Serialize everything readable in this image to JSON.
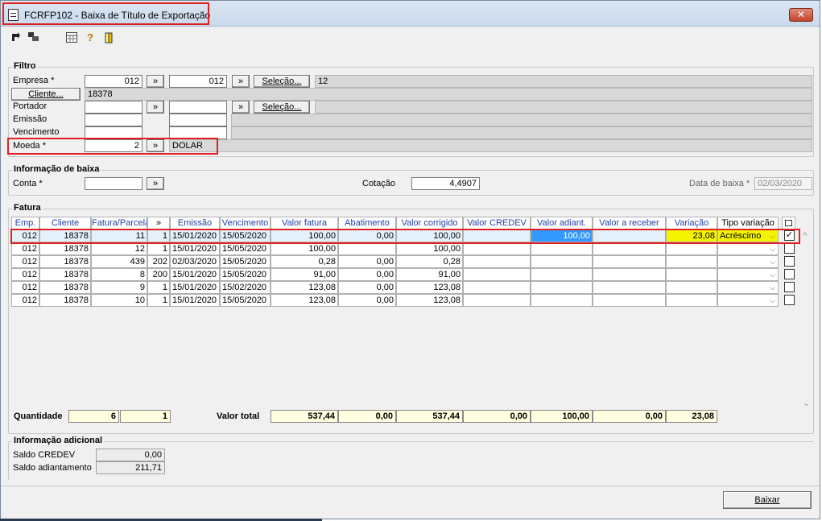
{
  "window": {
    "title": "FCRFP102 - Baixa de Título de Exportação",
    "close_symbol": "✕"
  },
  "toolbar": {
    "icons": [
      "arrow-left-icon",
      "grid-arrow-icon",
      "calendar-icon",
      "help-icon",
      "exit-door-icon"
    ]
  },
  "filtro": {
    "title": "Filtro",
    "empresa_label": "Empresa *",
    "empresa_from": "012",
    "empresa_to": "012",
    "selecao_label": "Seleção...",
    "empresa_selection": "12",
    "cliente_button": "Cliente...",
    "cliente_value": "18378",
    "portador_label": "Portador",
    "portador_selecao_label": "Seleção...",
    "emissao_label": "Emissão",
    "vencimento_label": "Vencimento",
    "moeda_label": "Moeda *",
    "moeda_value": "2",
    "moeda_name": "DOLAR",
    "lookup_symbol": "»"
  },
  "baixa": {
    "title": "Informação de baixa",
    "conta_label": "Conta *",
    "conta_value": "",
    "cotacao_label": "Cotação",
    "cotacao_value": "4,4907",
    "data_label": "Data de baixa *",
    "data_value": "02/03/2020"
  },
  "fatura": {
    "title": "Fatura",
    "columns": [
      "Emp.",
      "Cliente",
      "Fatura/Parcela",
      "»",
      "Emissão",
      "Vencimento",
      "Valor fatura",
      "Abatimento",
      "Valor corrigido",
      "Valor CREDEV",
      "Valor adiant.",
      "Valor a receber",
      "Variação",
      "Tipo variação"
    ],
    "rows": [
      {
        "emp": "012",
        "cliente": "18378",
        "fatura": "11",
        "parcela": "1",
        "emissao": "15/01/2020",
        "vencimento": "15/05/2020",
        "valor_fatura": "100,00",
        "abatimento": "0,00",
        "valor_corrigido": "100,00",
        "credev": "",
        "adiant": "100,00",
        "receber": "",
        "variacao": "23,08",
        "tipo": "Acréscimo",
        "checked": true
      },
      {
        "emp": "012",
        "cliente": "18378",
        "fatura": "12",
        "parcela": "1",
        "emissao": "15/01/2020",
        "vencimento": "15/05/2020",
        "valor_fatura": "100,00",
        "abatimento": "",
        "valor_corrigido": "100,00",
        "credev": "",
        "adiant": "",
        "receber": "",
        "variacao": "",
        "tipo": "",
        "checked": false
      },
      {
        "emp": "012",
        "cliente": "18378",
        "fatura": "439",
        "parcela": "202",
        "emissao": "02/03/2020",
        "vencimento": "15/05/2020",
        "valor_fatura": "0,28",
        "abatimento": "0,00",
        "valor_corrigido": "0,28",
        "credev": "",
        "adiant": "",
        "receber": "",
        "variacao": "",
        "tipo": "",
        "checked": false
      },
      {
        "emp": "012",
        "cliente": "18378",
        "fatura": "8",
        "parcela": "200",
        "emissao": "15/01/2020",
        "vencimento": "15/05/2020",
        "valor_fatura": "91,00",
        "abatimento": "0,00",
        "valor_corrigido": "91,00",
        "credev": "",
        "adiant": "",
        "receber": "",
        "variacao": "",
        "tipo": "",
        "checked": false
      },
      {
        "emp": "012",
        "cliente": "18378",
        "fatura": "9",
        "parcela": "1",
        "emissao": "15/01/2020",
        "vencimento": "15/02/2020",
        "valor_fatura": "123,08",
        "abatimento": "0,00",
        "valor_corrigido": "123,08",
        "credev": "",
        "adiant": "",
        "receber": "",
        "variacao": "",
        "tipo": "",
        "checked": false
      },
      {
        "emp": "012",
        "cliente": "18378",
        "fatura": "10",
        "parcela": "1",
        "emissao": "15/01/2020",
        "vencimento": "15/05/2020",
        "valor_fatura": "123,08",
        "abatimento": "0,00",
        "valor_corrigido": "123,08",
        "credev": "",
        "adiant": "",
        "receber": "",
        "variacao": "",
        "tipo": "",
        "checked": false
      }
    ],
    "check_mark": "✓",
    "dropdown_symbol": "⌵"
  },
  "totals": {
    "quantidade_label": "Quantidade",
    "quantidade_1": "6",
    "quantidade_2": "1",
    "valor_total_label": "Valor total",
    "valor_fatura": "537,44",
    "abatimento": "0,00",
    "valor_corrigido": "537,44",
    "credev": "0,00",
    "adiant": "100,00",
    "receber": "0,00",
    "variacao": "23,08"
  },
  "adicional": {
    "title": "Informação adicional",
    "saldo_credev_label": "Saldo CREDEV",
    "saldo_credev_value": "0,00",
    "saldo_adiant_label": "Saldo adiantamento",
    "saldo_adiant_value": "211,71"
  },
  "actions": {
    "baixar_label": "Baixar"
  }
}
